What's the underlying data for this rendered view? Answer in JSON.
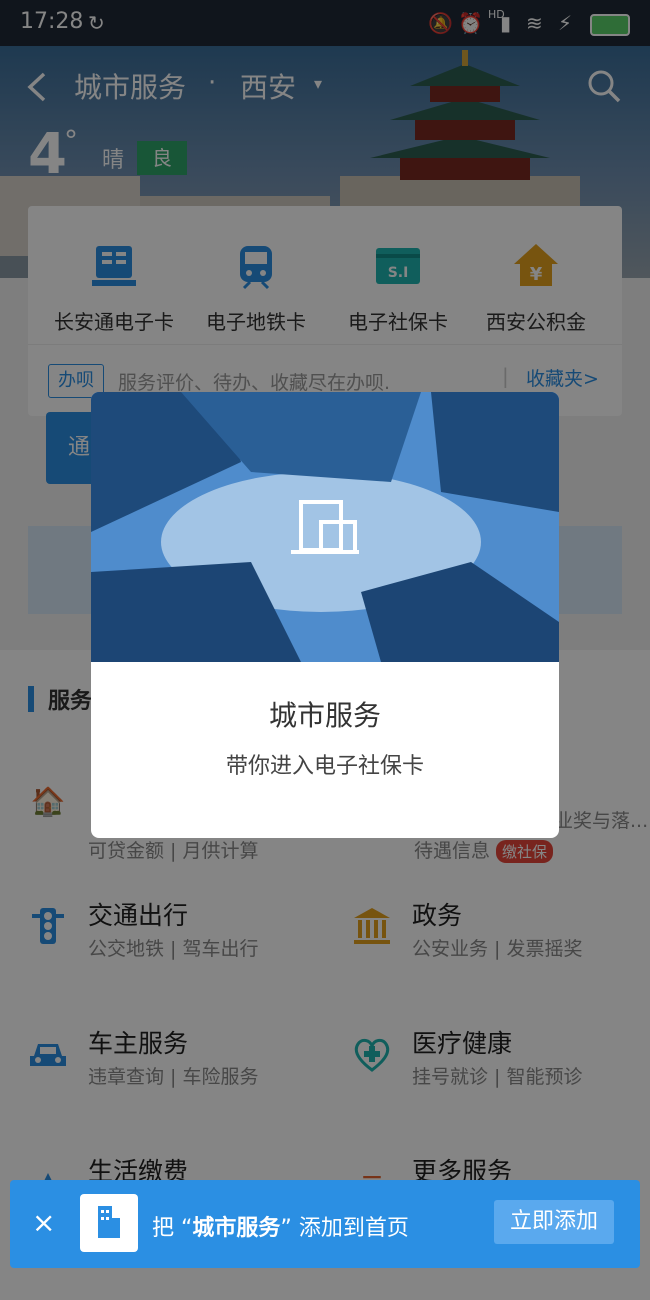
{
  "status_bar": {
    "time": "17:28",
    "network": "HD"
  },
  "header": {
    "title": "城市服务",
    "separator": "·",
    "city": "西安",
    "caret": "▾"
  },
  "weather": {
    "temp": "4",
    "deg": "°",
    "condition": "晴",
    "air_quality": "良"
  },
  "quick_cards": [
    {
      "label": "长安通电子卡",
      "icon": "card-reader-icon"
    },
    {
      "label": "电子地铁卡",
      "icon": "metro-icon"
    },
    {
      "label": "电子社保卡",
      "icon": "social-security-icon"
    },
    {
      "label": "西安公积金",
      "icon": "housing-fund-icon"
    }
  ],
  "banli": {
    "badge": "办呗",
    "tip": "服务评价、待办、收藏尽在办呗.",
    "divider": "|",
    "favorites": "收藏夹>"
  },
  "obscured": {
    "tab": "通"
  },
  "services_section": {
    "title": "服务"
  },
  "services": [
    {
      "name": "",
      "sub": "可贷金额 | 月供计算",
      "icon": "yuan-icon",
      "color": "#e5a21e"
    },
    {
      "name": "",
      "sub": "待遇信息",
      "tag": "缴社保",
      "icon": "",
      "color": "#2b8fe3"
    },
    {
      "name": "交通出行",
      "sub": "公交地铁 | 驾车出行",
      "icon": "traffic-light-icon",
      "color": "#2b8fe3"
    },
    {
      "name": "政务",
      "sub": "公安业务 | 发票摇奖",
      "icon": "government-icon",
      "color": "#e5a21e"
    },
    {
      "name": "车主服务",
      "sub": "违章查询 | 车险服务",
      "icon": "car-icon",
      "color": "#2b8fe3"
    },
    {
      "name": "医疗健康",
      "sub": "挂号就诊 | 智能预诊",
      "icon": "health-icon",
      "color": "#1fb5b0"
    },
    {
      "name": "生活缴费",
      "sub": "",
      "icon": "payment-icon",
      "color": "#2b8fe3"
    },
    {
      "name": "更多服务",
      "sub": "",
      "icon": "more-icon",
      "color": "#e5622e"
    }
  ],
  "partial_text": {
    "right_row1": "业奖与落..."
  },
  "modal": {
    "title": "城市服务",
    "subtitle": "带你进入电子社保卡"
  },
  "banner": {
    "close": "×",
    "prefix": "把 “",
    "app_name": "城市服务",
    "suffix": "” 添加到首页",
    "button": "立即添加"
  }
}
